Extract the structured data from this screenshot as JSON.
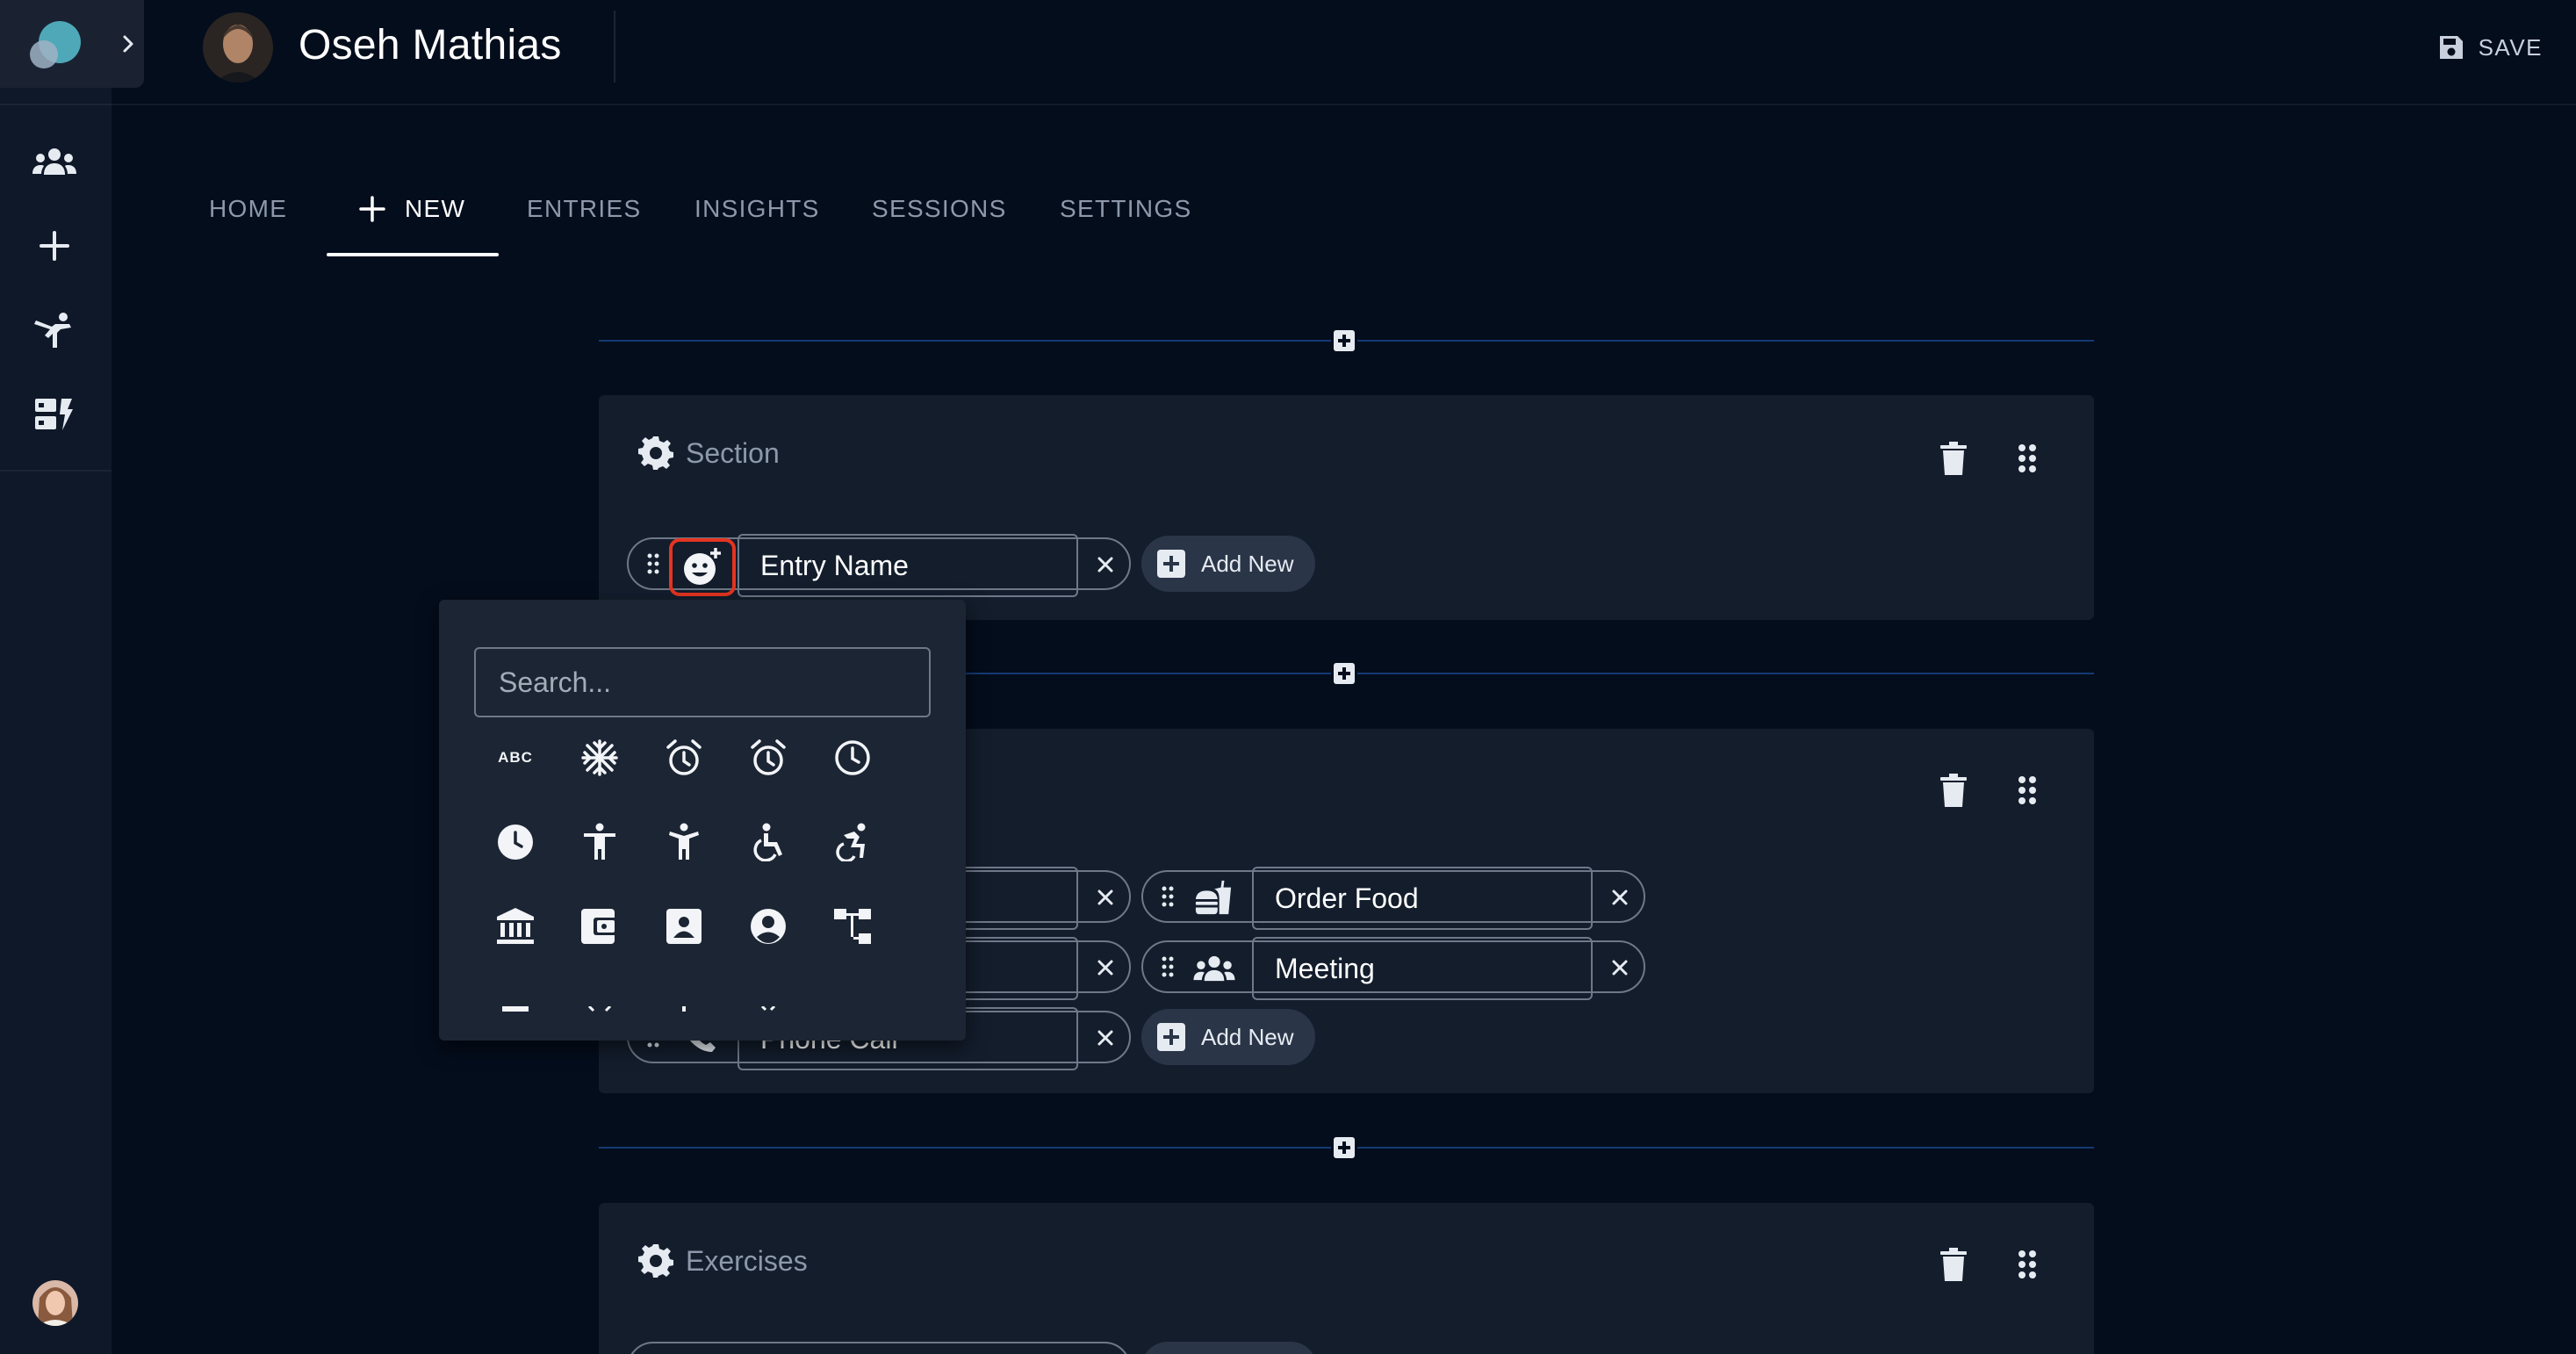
{
  "user": {
    "name": "Oseh Mathias"
  },
  "header": {
    "save_label": "SAVE"
  },
  "tabs": [
    {
      "label": "HOME"
    },
    {
      "label": "NEW"
    },
    {
      "label": "ENTRIES"
    },
    {
      "label": "INSIGHTS"
    },
    {
      "label": "SESSIONS"
    },
    {
      "label": "SETTINGS"
    }
  ],
  "active_tab": "NEW",
  "sections": [
    {
      "title": "Section",
      "entries": [
        {
          "name": "Entry Name",
          "icon": "add-reaction-icon"
        }
      ],
      "add_label": "Add New"
    },
    {
      "title": "",
      "entries": [
        {
          "name": "",
          "icon": ""
        },
        {
          "name": "Order Food",
          "icon": "fastfood-icon"
        },
        {
          "name": "",
          "icon": ""
        },
        {
          "name": "Meeting",
          "icon": "groups-icon"
        },
        {
          "name": "Phone Call",
          "icon": "phone-icon"
        }
      ],
      "add_label": "Add New"
    },
    {
      "title": "Exercises",
      "entries": []
    }
  ],
  "picker": {
    "search_placeholder": "Search...",
    "abc_label": "ABC",
    "icons": [
      "abc-icon",
      "ac-unit-icon",
      "access-alarm-icon",
      "access-alarms-icon",
      "access-time-icon",
      "access-time-filled-icon",
      "accessibility-icon",
      "accessibility-new-icon",
      "accessible-icon",
      "accessible-forward-icon",
      "account-balance-icon",
      "account-balance-wallet-icon",
      "account-box-icon",
      "account-circle-icon",
      "account-tree-icon"
    ]
  }
}
